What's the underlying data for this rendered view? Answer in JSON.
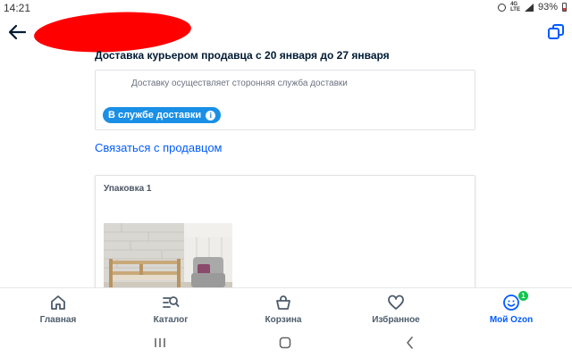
{
  "status_bar": {
    "time": "14:21",
    "battery_percent": "93%",
    "icons": [
      "alarm-icon",
      "lte-icon",
      "signal-icon",
      "battery-icon"
    ]
  },
  "header": {
    "back_icon": "arrow-left-icon",
    "copy_icon": "copy-icon"
  },
  "delivery": {
    "title": "Доставка курьером продавца с 20 января до 27 января",
    "note": "Доставку осуществляет сторонняя служба доставки",
    "badge_label": "В службе доставки",
    "badge_info_glyph": "i",
    "badge_color": "#1a8fe6"
  },
  "contact_link": "Связаться с продавцом",
  "package": {
    "title": "Упаковка 1"
  },
  "bottom_nav": {
    "items": [
      {
        "label": "Главная",
        "icon": "home-icon"
      },
      {
        "label": "Каталог",
        "icon": "catalog-icon"
      },
      {
        "label": "Корзина",
        "icon": "cart-icon"
      },
      {
        "label": "Избранное",
        "icon": "heart-icon"
      },
      {
        "label": "Мой Ozon",
        "icon": "profile-icon",
        "badge": "1",
        "active": true
      }
    ],
    "active_color": "#005bff",
    "badge_color": "#10c44c"
  },
  "system_nav": {
    "buttons": [
      "recents-icon",
      "home-circle-icon",
      "back-chevron-icon"
    ]
  }
}
